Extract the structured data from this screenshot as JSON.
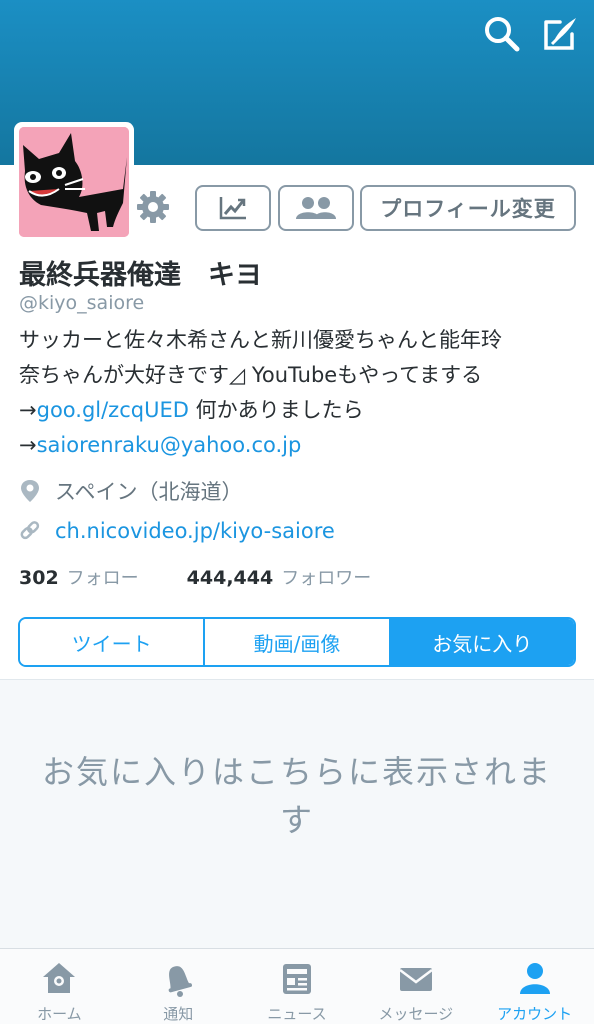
{
  "profile": {
    "display_name": "最終兵器俺達　キヨ",
    "handle": "@kiyo_saiore",
    "bio": {
      "line1": "サッカーと佐々木希さんと新川優愛ちゃんと能年玲",
      "line2": "奈ちゃんが大好きです◿ YouTubeもやってまする",
      "arrow1": "→",
      "link1": "goo.gl/zcqUED",
      "after_link1": " 何かありましたら",
      "arrow2": "→",
      "link2": "saiorenraku@yahoo.co.jp"
    },
    "location": "スペイン（北海道）",
    "url": "ch.nicovideo.jp/kiyo-saiore",
    "following_count": "302",
    "following_label": "フォロー",
    "followers_count": "444,444",
    "followers_label": "フォロワー"
  },
  "actions": {
    "edit_profile_label": "プロフィール変更"
  },
  "tabs": [
    {
      "label": "ツイート",
      "active": false
    },
    {
      "label": "動画/画像",
      "active": false
    },
    {
      "label": "お気に入り",
      "active": true
    }
  ],
  "empty_state": {
    "message": "お気に入りはこちらに表示されます"
  },
  "tabbar": [
    {
      "label": "ホーム",
      "icon": "home-icon",
      "active": false
    },
    {
      "label": "通知",
      "icon": "bell-icon",
      "active": false
    },
    {
      "label": "ニュース",
      "icon": "news-icon",
      "active": false
    },
    {
      "label": "メッセージ",
      "icon": "envelope-icon",
      "active": false
    },
    {
      "label": "アカウント",
      "icon": "person-icon",
      "active": true
    }
  ],
  "colors": {
    "header": "#1b8fc4",
    "accent": "#1da1f2",
    "muted": "#8899a6"
  }
}
